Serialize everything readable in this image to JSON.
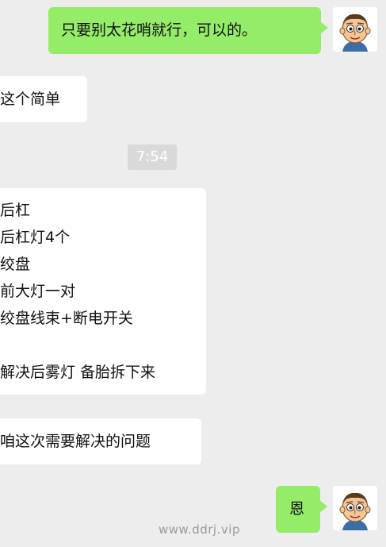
{
  "messages": {
    "m1": {
      "text": "只要别太花哨就行，可以的。"
    },
    "m2": {
      "text": "这个简单"
    },
    "timestamp": "7:54",
    "m3": {
      "lines": [
        "后杠",
        "后杠灯4个",
        "绞盘",
        "前大灯一对",
        "绞盘线束+断电开关",
        "解决后雾灯 备胎拆下来"
      ]
    },
    "m4": {
      "text": "咱这次需要解决的问题"
    },
    "m5": {
      "text": "恩"
    }
  },
  "watermark": "www.ddrj.vip",
  "colors": {
    "background": "#ededed",
    "outgoing_bubble": "#95ec69",
    "incoming_bubble": "#ffffff",
    "timestamp_bg": "#dadada"
  },
  "icons": {
    "self_avatar": "cartoon-boy-avatar-icon"
  }
}
